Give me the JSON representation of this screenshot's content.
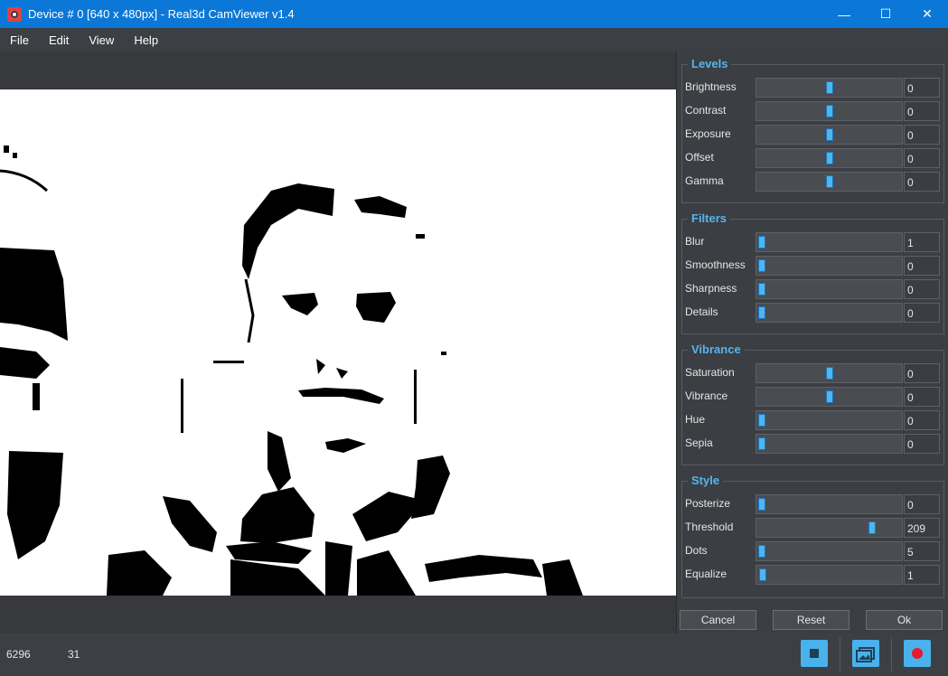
{
  "window": {
    "title": "Device # 0 [640 x 480px] - Real3d CamViewer v1.4",
    "controls": {
      "minimize": "—",
      "maximize": "☐",
      "close": "✕"
    }
  },
  "menu": [
    "File",
    "Edit",
    "View",
    "Help"
  ],
  "panel": {
    "groups": [
      {
        "title": "Levels",
        "rows": [
          {
            "label": "Brightness",
            "value": "0",
            "level": 0.5
          },
          {
            "label": "Contrast",
            "value": "0",
            "level": 0.5
          },
          {
            "label": "Exposure",
            "value": "0",
            "level": 0.5
          },
          {
            "label": "Offset",
            "value": "0",
            "level": 0.5
          },
          {
            "label": "Gamma",
            "value": "0",
            "level": 0.5
          }
        ]
      },
      {
        "title": "Filters",
        "rows": [
          {
            "label": "Blur",
            "value": "1",
            "level": 0.0
          },
          {
            "label": "Smoothness",
            "value": "0",
            "level": 0.0
          },
          {
            "label": "Sharpness",
            "value": "0",
            "level": 0.0
          },
          {
            "label": "Details",
            "value": "0",
            "level": 0.0
          }
        ]
      },
      {
        "title": "Vibrance",
        "rows": [
          {
            "label": "Saturation",
            "value": "0",
            "level": 0.5
          },
          {
            "label": "Vibrance",
            "value": "0",
            "level": 0.5
          },
          {
            "label": "Hue",
            "value": "0",
            "level": 0.0
          },
          {
            "label": "Sepia",
            "value": "0",
            "level": 0.0
          }
        ]
      },
      {
        "title": "Style",
        "rows": [
          {
            "label": "Posterize",
            "value": "0",
            "level": 0.0
          },
          {
            "label": "Threshold",
            "value": "209",
            "level": 0.82
          },
          {
            "label": "Dots",
            "value": "5",
            "level": 0.0
          },
          {
            "label": "Equalize",
            "value": "1",
            "level": 0.01
          }
        ]
      }
    ],
    "buttons": {
      "cancel": "Cancel",
      "reset": "Reset",
      "ok": "Ok"
    }
  },
  "status": {
    "left_value": "6296",
    "right_value": "31"
  },
  "toolbar": {
    "icons": [
      "stop-icon",
      "image-icon",
      "record-icon"
    ]
  },
  "colors": {
    "accent": "#49b2ec",
    "titlebar": "#0b78d7",
    "record": "#e8192c"
  }
}
